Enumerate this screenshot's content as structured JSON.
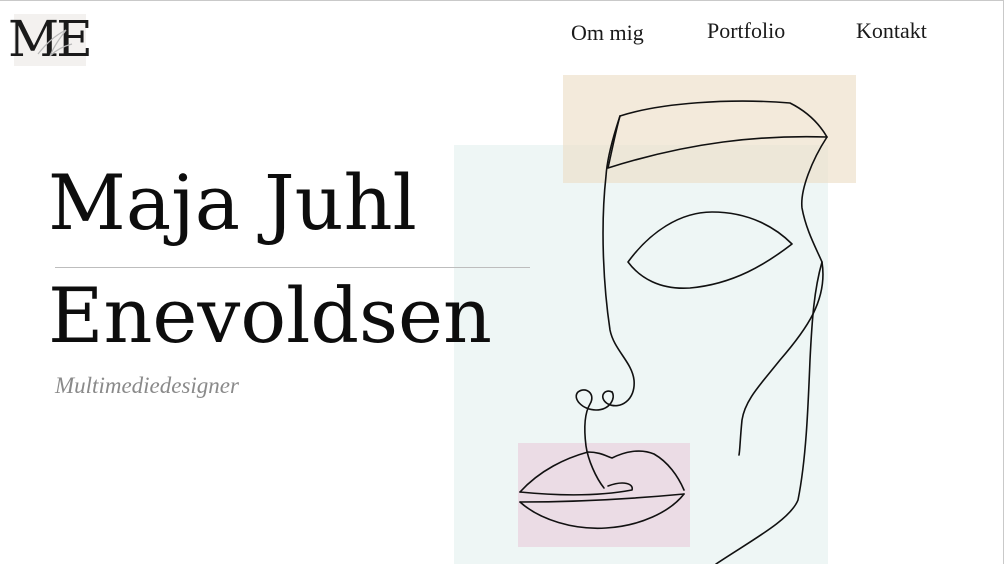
{
  "logo": {
    "text": "ME",
    "icon": "script-flourish-icon"
  },
  "nav": {
    "items": [
      {
        "label": "Om mig"
      },
      {
        "label": "Portfolio"
      },
      {
        "label": "Kontakt"
      }
    ]
  },
  "hero": {
    "name_line_1": "Maja Juhl",
    "name_line_2": "Enevoldsen",
    "subtitle": "Multimediedesigner"
  },
  "artwork": {
    "icon": "line-art-face-icon",
    "colors": {
      "mint": "#eef6f5",
      "beige": "#ecdec7",
      "pink": "#ead2de",
      "line": "#111111"
    }
  }
}
